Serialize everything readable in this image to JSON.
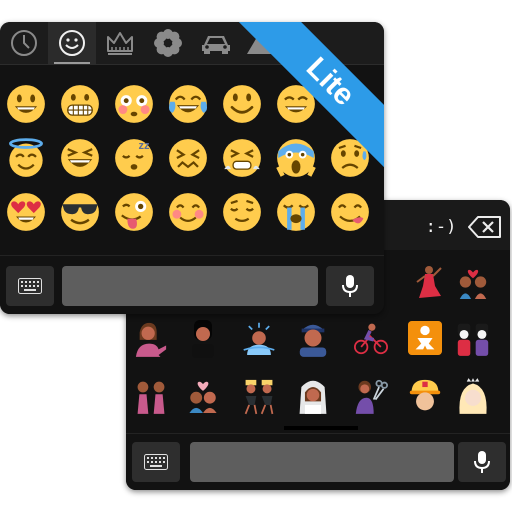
{
  "front_keyboard": {
    "tabs": [
      {
        "icon": "clock-icon",
        "active": false
      },
      {
        "icon": "smiley-icon",
        "active": true
      },
      {
        "icon": "crown-icon",
        "active": false
      },
      {
        "icon": "flower-icon",
        "active": false
      },
      {
        "icon": "car-icon",
        "active": false
      },
      {
        "icon": "triangle-icon",
        "active": false
      }
    ],
    "badge": "Lite",
    "emoji_rows": [
      [
        "grinning",
        "grimacing",
        "flushed",
        "tears-of-joy",
        "smiling",
        "beaming",
        "smiling-partial"
      ],
      [
        "halo",
        "laughing",
        "sleeping",
        "confounded",
        "persevering",
        "screaming",
        "anxious-sweat"
      ],
      [
        "heart-eyes",
        "sunglasses",
        "tongue-wink",
        "blush",
        "relieved",
        "loudly-crying",
        "yum"
      ]
    ]
  },
  "back_keyboard": {
    "emoticon_tab": ":-)",
    "backspace_icon": "backspace-icon",
    "emoji_rows": [
      [
        "dancer-flamenco",
        "couple-heart"
      ],
      [
        "person-pointing",
        "person-dark-hair",
        "people-splashing",
        "police-officer",
        "cyclist",
        "baby-symbol",
        "geishas"
      ],
      [
        "two-women",
        "kiss",
        "dancers",
        "bride-with-veil",
        "woman-with-scissors",
        "construction-worker",
        "princess"
      ]
    ]
  },
  "colors": {
    "emoji_yellow": "#ffcc4d",
    "panel_bg": "#121212",
    "banner_blue": "#2d9be8"
  }
}
